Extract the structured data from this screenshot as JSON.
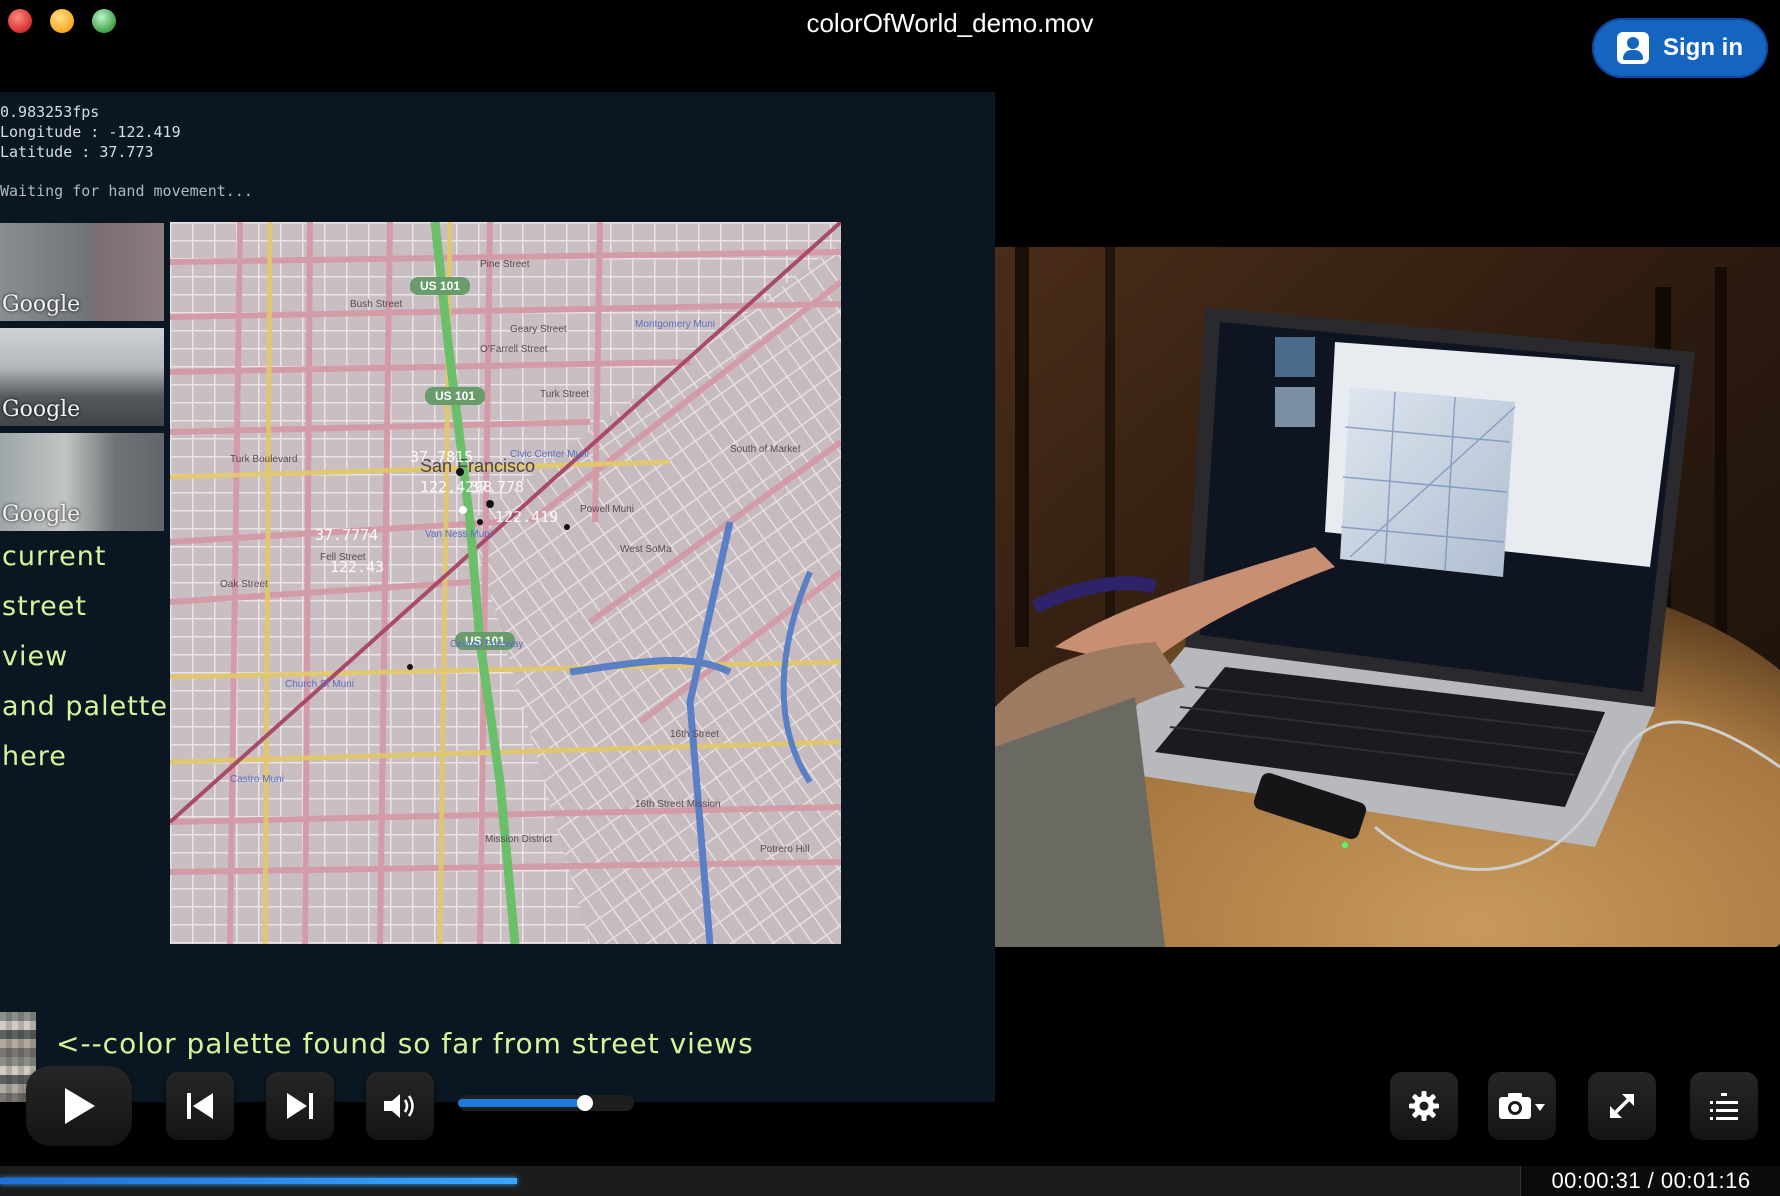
{
  "window": {
    "title": "colorOfWorld_demo.mov",
    "sign_in_label": "Sign in"
  },
  "video_left": {
    "fps": "0.983253fps",
    "longitude": "Longitude : -122.419",
    "latitude": "Latitude : 37.773",
    "status": "Waiting for hand movement...",
    "thumbnails": [
      {
        "watermark": "Google"
      },
      {
        "watermark": "Google"
      },
      {
        "watermark": "Google"
      }
    ],
    "annotation_lines": [
      "current",
      "street",
      "view",
      "and palette",
      "here"
    ],
    "palette_caption": "<--color palette found so far from street views",
    "map": {
      "city_label": "San Francisco",
      "coord_labels": [
        "37.7815",
        "122.4298",
        "37.778",
        "122.419",
        "37.7774",
        "122.43"
      ],
      "highway_shields": [
        "US 101",
        "US 101",
        "US 101"
      ],
      "street_labels": [
        "Pine Street",
        "Bush Street",
        "Geary Street",
        "O'Farrell Street",
        "Turk Street",
        "Turk Boulevard",
        "Fell Street",
        "Oak Street",
        "16th Street",
        "Mission District",
        "Potrero Hill",
        "Castro Muni",
        "Church St Muni",
        "Civic Center Muni",
        "Powell Muni",
        "Montgomery Muni",
        "South of Market",
        "West SoMa",
        "Van Ness Muni",
        "Central Freeway",
        "16th Street Mission"
      ]
    }
  },
  "controls": {
    "play_icon": "play-icon",
    "prev_icon": "skip-back-icon",
    "next_icon": "skip-forward-icon",
    "volume_icon": "speaker-icon",
    "volume_level": 0.72,
    "settings_icon": "gear-icon",
    "snapshot_icon": "camera-icon",
    "fullscreen_icon": "expand-icon",
    "playlist_icon": "list-icon",
    "progress": 0.34,
    "time_display": "00:00:31 / 00:01:16"
  }
}
